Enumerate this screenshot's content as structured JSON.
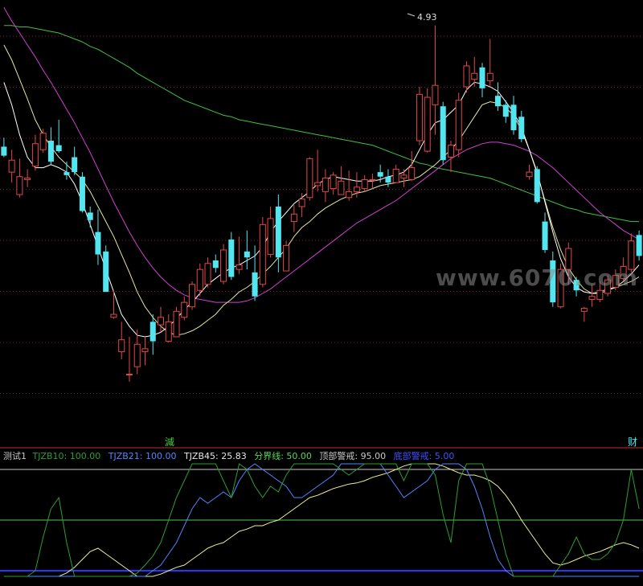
{
  "watermark": "www.6070.com",
  "price_annotation": "4.93",
  "markers": {
    "left": "減",
    "right": "财"
  },
  "indicator_legend": [
    {
      "label": "测试1",
      "color": "#c8c8c8"
    },
    {
      "label": "TJZB10: 100.00",
      "color": "#2e9e2e"
    },
    {
      "label": "TJZB21: 100.00",
      "color": "#4f86ff"
    },
    {
      "label": "TJZB45: 25.83",
      "color": "#e6e6e6"
    },
    {
      "label": "分界线: 50.00",
      "color": "#5ad45a"
    },
    {
      "label": "顶部警戒: 95.00",
      "color": "#c8c8c8"
    },
    {
      "label": "底部警戒: 5.00",
      "color": "#3c50ff"
    }
  ],
  "colors": {
    "up": "#e04848",
    "down": "#54e6f0",
    "ma5": "#ffffff",
    "ma10": "#e6e6a0",
    "ma20": "#d040d0",
    "ma60": "#40c040",
    "tj10": "#2e9e2e",
    "tj21": "#4f86ff",
    "tj45": "#eeee99",
    "mid": "#4ccc4c",
    "top": "#c8c8c8",
    "bottom": "#3030ff"
  },
  "chart_data": [
    {
      "type": "candlestick",
      "ylim": [
        2.2,
        5.1
      ],
      "annotated_high": 4.93,
      "candles": [
        [
          4.12,
          4.18,
          4.05,
          4.06
        ],
        [
          3.95,
          4.1,
          3.88,
          4.03
        ],
        [
          3.8,
          4.04,
          3.78,
          3.92
        ],
        [
          3.9,
          3.97,
          3.85,
          3.91
        ],
        [
          3.99,
          4.2,
          3.96,
          4.14
        ],
        [
          4.1,
          4.24,
          4.08,
          4.21
        ],
        [
          4.16,
          4.25,
          4.0,
          4.02
        ],
        [
          4.13,
          4.3,
          4.08,
          4.09
        ],
        [
          3.95,
          4.02,
          3.9,
          3.93
        ],
        [
          4.05,
          4.12,
          3.93,
          3.95
        ],
        [
          3.92,
          3.95,
          3.68,
          3.69
        ],
        [
          3.68,
          3.72,
          3.58,
          3.63
        ],
        [
          3.55,
          3.7,
          3.33,
          3.4
        ],
        [
          3.42,
          3.46,
          3.15,
          3.15
        ],
        [
          2.98,
          3.16,
          2.97,
          3.0
        ],
        [
          2.75,
          2.95,
          2.7,
          2.83
        ],
        [
          2.6,
          2.85,
          2.55,
          2.6
        ],
        [
          2.65,
          2.9,
          2.6,
          2.8
        ],
        [
          2.75,
          2.85,
          2.66,
          2.77
        ],
        [
          2.95,
          3.0,
          2.73,
          2.82
        ],
        [
          2.93,
          3.05,
          2.88,
          2.98
        ],
        [
          2.82,
          3.0,
          2.81,
          2.95
        ],
        [
          2.85,
          3.05,
          2.85,
          3.02
        ],
        [
          2.98,
          3.12,
          2.96,
          3.08
        ],
        [
          3.05,
          3.22,
          3.03,
          3.2
        ],
        [
          3.16,
          3.34,
          3.12,
          3.3
        ],
        [
          3.2,
          3.38,
          3.18,
          3.34
        ],
        [
          3.36,
          3.4,
          3.28,
          3.31
        ],
        [
          3.22,
          3.47,
          3.2,
          3.43
        ],
        [
          3.5,
          3.55,
          3.23,
          3.25
        ],
        [
          3.3,
          3.52,
          3.27,
          3.33
        ],
        [
          3.42,
          3.56,
          3.3,
          3.38
        ],
        [
          3.28,
          3.46,
          3.09,
          3.12
        ],
        [
          3.2,
          3.65,
          3.18,
          3.6
        ],
        [
          3.4,
          3.72,
          3.38,
          3.64
        ],
        [
          3.72,
          3.8,
          3.28,
          3.38
        ],
        [
          3.29,
          3.49,
          3.29,
          3.46
        ],
        [
          3.62,
          3.73,
          3.55,
          3.67
        ],
        [
          3.72,
          3.81,
          3.65,
          3.77
        ],
        [
          3.78,
          4.05,
          3.76,
          4.04
        ],
        [
          3.86,
          4.1,
          3.82,
          3.88
        ],
        [
          3.82,
          3.97,
          3.75,
          3.91
        ],
        [
          3.84,
          3.95,
          3.8,
          3.93
        ],
        [
          3.8,
          3.99,
          3.8,
          3.89
        ],
        [
          3.78,
          3.96,
          3.76,
          3.82
        ],
        [
          3.82,
          3.95,
          3.78,
          3.85
        ],
        [
          3.84,
          3.93,
          3.82,
          3.9
        ],
        [
          3.9,
          3.94,
          3.84,
          3.9
        ],
        [
          3.95,
          4.0,
          3.88,
          3.92
        ],
        [
          3.92,
          3.97,
          3.85,
          3.88
        ],
        [
          3.88,
          4.0,
          3.88,
          3.97
        ],
        [
          3.91,
          3.97,
          3.85,
          3.93
        ],
        [
          3.9,
          4.09,
          3.89,
          3.98
        ],
        [
          4.16,
          4.52,
          4.13,
          4.47
        ],
        [
          4.09,
          4.51,
          4.08,
          4.45
        ],
        [
          4.4,
          4.93,
          4.2,
          4.53
        ],
        [
          4.39,
          4.42,
          4.0,
          4.03
        ],
        [
          4.05,
          4.16,
          3.95,
          4.13
        ],
        [
          4.1,
          4.48,
          4.05,
          4.43
        ],
        [
          4.52,
          4.69,
          4.48,
          4.66
        ],
        [
          4.57,
          4.72,
          4.52,
          4.61
        ],
        [
          4.65,
          4.68,
          4.45,
          4.51
        ],
        [
          4.56,
          4.84,
          4.52,
          4.61
        ],
        [
          4.46,
          4.55,
          4.36,
          4.39
        ],
        [
          4.4,
          4.43,
          4.28,
          4.32
        ],
        [
          4.4,
          4.46,
          4.2,
          4.23
        ],
        [
          4.32,
          4.36,
          4.15,
          4.17
        ],
        [
          3.92,
          4.0,
          3.9,
          3.95
        ],
        [
          3.97,
          3.99,
          3.74,
          3.75
        ],
        [
          3.62,
          3.68,
          3.41,
          3.43
        ],
        [
          3.36,
          3.42,
          3.05,
          3.08
        ],
        [
          3.05,
          3.34,
          3.04,
          3.3
        ],
        [
          3.3,
          3.48,
          3.2,
          3.44
        ],
        [
          3.23,
          3.25,
          3.12,
          3.16
        ],
        [
          3.02,
          3.05,
          2.95,
          3.04
        ],
        [
          3.1,
          3.2,
          3.05,
          3.12
        ],
        [
          3.1,
          3.22,
          3.08,
          3.16
        ],
        [
          3.14,
          3.26,
          3.12,
          3.23
        ],
        [
          3.18,
          3.3,
          3.16,
          3.26
        ],
        [
          3.24,
          3.38,
          3.22,
          3.32
        ],
        [
          3.3,
          3.54,
          3.28,
          3.49
        ],
        [
          3.53,
          3.56,
          3.36,
          3.39
        ]
      ],
      "moving_averages": {
        "ma5": [
          4.55,
          4.4,
          4.2,
          4.05,
          3.98,
          3.98,
          4.0,
          3.98,
          3.95,
          3.87,
          3.75,
          3.6,
          3.45,
          3.3,
          3.15,
          3.0,
          2.92,
          2.86,
          2.85,
          2.86,
          2.88,
          2.92,
          2.97,
          3.03,
          3.08,
          3.14,
          3.2,
          3.24,
          3.28,
          3.31,
          3.33,
          3.36,
          3.39,
          3.45,
          3.55,
          3.62,
          3.68,
          3.74,
          3.78,
          3.82,
          3.87,
          3.9,
          3.92,
          3.91,
          3.9,
          3.89,
          3.89,
          3.89,
          3.9,
          3.92,
          3.93,
          3.95,
          4.0,
          4.1,
          4.2,
          4.28,
          4.3,
          4.35,
          4.4,
          4.5,
          4.55,
          4.54,
          4.52,
          4.49,
          4.42,
          4.35,
          4.25,
          4.1,
          3.95,
          3.75,
          3.55,
          3.37,
          3.25,
          3.18,
          3.15,
          3.14,
          3.14,
          3.16,
          3.18,
          3.22,
          3.27,
          3.33
        ],
        "ma10": [
          4.8,
          4.7,
          4.57,
          4.44,
          4.3,
          4.2,
          4.12,
          4.05,
          4.0,
          3.95,
          3.9,
          3.82,
          3.72,
          3.62,
          3.52,
          3.4,
          3.28,
          3.15,
          3.05,
          2.98,
          2.92,
          2.88,
          2.86,
          2.87,
          2.89,
          2.92,
          2.96,
          3.0,
          3.06,
          3.1,
          3.15,
          3.18,
          3.22,
          3.27,
          3.32,
          3.38,
          3.44,
          3.52,
          3.58,
          3.62,
          3.67,
          3.71,
          3.74,
          3.77,
          3.79,
          3.81,
          3.82,
          3.84,
          3.86,
          3.87,
          3.88,
          3.89,
          3.9,
          3.92,
          3.96,
          4.0,
          4.05,
          4.1,
          4.16,
          4.24,
          4.32,
          4.4,
          4.42,
          4.41,
          4.38,
          4.33,
          4.23,
          4.1,
          3.94,
          3.76,
          3.58,
          3.43,
          3.31,
          3.23,
          3.17,
          3.14,
          3.15,
          3.17,
          3.18,
          3.2,
          3.22,
          3.25
        ],
        "ma20": [
          5.05,
          4.96,
          4.88,
          4.8,
          4.72,
          4.63,
          4.55,
          4.46,
          4.37,
          4.28,
          4.18,
          4.08,
          3.97,
          3.86,
          3.75,
          3.65,
          3.55,
          3.46,
          3.38,
          3.31,
          3.25,
          3.2,
          3.16,
          3.13,
          3.11,
          3.1,
          3.09,
          3.08,
          3.08,
          3.08,
          3.08,
          3.09,
          3.11,
          3.14,
          3.17,
          3.21,
          3.25,
          3.29,
          3.33,
          3.37,
          3.41,
          3.45,
          3.49,
          3.53,
          3.57,
          3.61,
          3.64,
          3.67,
          3.7,
          3.73,
          3.76,
          3.8,
          3.84,
          3.88,
          3.92,
          3.96,
          4.0,
          4.04,
          4.07,
          4.1,
          4.12,
          4.14,
          4.15,
          4.15,
          4.14,
          4.13,
          4.11,
          4.09,
          4.06,
          4.02,
          3.98,
          3.93,
          3.88,
          3.83,
          3.78,
          3.73,
          3.68,
          3.64,
          3.6,
          3.56,
          3.53,
          3.5
        ],
        "ma60": [
          4.93,
          4.93,
          4.92,
          4.92,
          4.91,
          4.9,
          4.89,
          4.88,
          4.86,
          4.84,
          4.82,
          4.79,
          4.77,
          4.74,
          4.71,
          4.68,
          4.65,
          4.61,
          4.58,
          4.55,
          4.52,
          4.49,
          4.46,
          4.43,
          4.41,
          4.39,
          4.37,
          4.35,
          4.33,
          4.32,
          4.3,
          4.29,
          4.28,
          4.27,
          4.26,
          4.25,
          4.24,
          4.23,
          4.22,
          4.21,
          4.2,
          4.19,
          4.18,
          4.17,
          4.16,
          4.15,
          4.14,
          4.13,
          4.11,
          4.09,
          4.07,
          4.05,
          4.03,
          4.01,
          4.0,
          3.98,
          3.97,
          3.96,
          3.95,
          3.94,
          3.93,
          3.92,
          3.91,
          3.89,
          3.87,
          3.85,
          3.83,
          3.81,
          3.79,
          3.77,
          3.75,
          3.73,
          3.71,
          3.7,
          3.68,
          3.67,
          3.66,
          3.65,
          3.64,
          3.63,
          3.62,
          3.62
        ]
      }
    },
    {
      "type": "line",
      "title": "测试1",
      "ylim": [
        0,
        100
      ],
      "x_count": 82,
      "series": [
        {
          "name": "TJZB10",
          "values": [
            0,
            0,
            0,
            0,
            5,
            35,
            60,
            70,
            30,
            0,
            0,
            0,
            0,
            0,
            0,
            0,
            0,
            3,
            10,
            18,
            30,
            50,
            70,
            85,
            100,
            100,
            100,
            100,
            85,
            70,
            100,
            95,
            80,
            70,
            80,
            75,
            90,
            100,
            100,
            100,
            100,
            100,
            100,
            95,
            90,
            95,
            100,
            100,
            100,
            100,
            100,
            85,
            100,
            100,
            100,
            90,
            55,
            30,
            85,
            100,
            100,
            100,
            80,
            50,
            20,
            0,
            0,
            0,
            0,
            0,
            0,
            10,
            20,
            35,
            20,
            15,
            15,
            20,
            30,
            50,
            95,
            60
          ]
        },
        {
          "name": "TJZB21",
          "values": [
            0,
            0,
            0,
            0,
            0,
            0,
            0,
            0,
            0,
            0,
            0,
            0,
            0,
            0,
            0,
            0,
            0,
            0,
            0,
            5,
            10,
            20,
            30,
            45,
            60,
            70,
            65,
            70,
            75,
            70,
            85,
            95,
            100,
            95,
            90,
            85,
            80,
            70,
            70,
            75,
            80,
            85,
            90,
            100,
            100,
            100,
            100,
            100,
            100,
            90,
            80,
            70,
            75,
            80,
            85,
            95,
            100,
            100,
            100,
            95,
            80,
            60,
            35,
            15,
            5,
            0,
            0,
            0,
            0,
            0,
            0,
            0,
            0,
            0,
            0,
            0,
            0,
            0,
            0,
            0,
            0,
            0
          ]
        },
        {
          "name": "TJZB45",
          "values": [
            0,
            0,
            0,
            0,
            0,
            0,
            0,
            0,
            3,
            8,
            15,
            22,
            25,
            20,
            15,
            10,
            5,
            0,
            0,
            0,
            2,
            5,
            8,
            10,
            15,
            20,
            25,
            28,
            30,
            35,
            40,
            42,
            45,
            45,
            48,
            50,
            55,
            60,
            65,
            70,
            72,
            75,
            78,
            80,
            82,
            83,
            85,
            88,
            90,
            92,
            95,
            98,
            100,
            100,
            100,
            100,
            98,
            95,
            92,
            90,
            90,
            88,
            85,
            80,
            72,
            62,
            50,
            40,
            30,
            20,
            12,
            10,
            12,
            15,
            18,
            20,
            22,
            25,
            28,
            30,
            28,
            25
          ]
        },
        {
          "name": "分界线",
          "values": [
            50
          ]
        },
        {
          "name": "顶部警戒",
          "values": [
            95
          ]
        },
        {
          "name": "底部警戒",
          "values": [
            5
          ]
        }
      ]
    }
  ]
}
